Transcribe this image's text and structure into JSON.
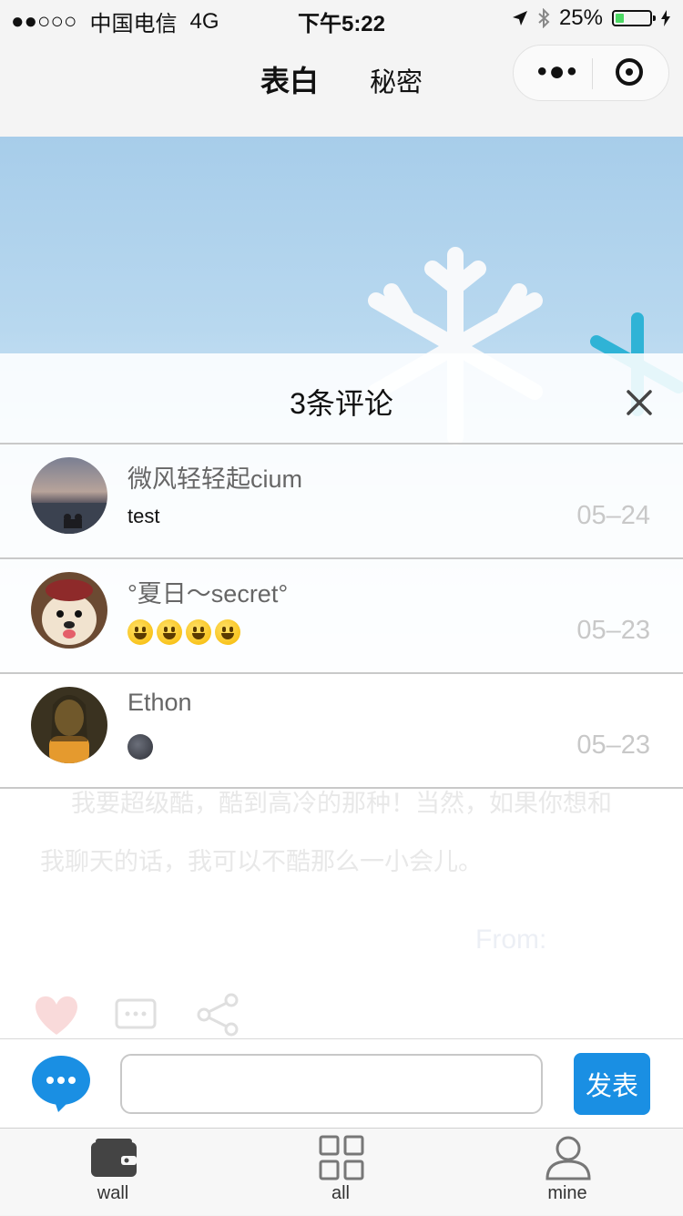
{
  "status_bar": {
    "signal": "●●○○○",
    "carrier": "中国电信",
    "network": "4G",
    "time": "下午5:22",
    "battery_text": "25%",
    "battery_level": 0.25
  },
  "nav": {
    "tab_active": "表白",
    "tab_other": "秘密"
  },
  "sheet": {
    "title": "3条评论",
    "comments": [
      {
        "name": "微风轻轻起cium",
        "text": "test",
        "date": "05–24",
        "avatar": "sunset-avatar"
      },
      {
        "name": "°夏日～secret°",
        "text": "",
        "emoji": [
          "grinning-face",
          "grinning-face",
          "grinning-face",
          "grinning-face"
        ],
        "date": "05–23",
        "avatar": "dog-avatar"
      },
      {
        "name": "Ethon",
        "text": "",
        "emoji": [
          "new-moon-face"
        ],
        "date": "05–23",
        "avatar": "mona-lisa-avatar"
      }
    ]
  },
  "background_post": {
    "line1": "我要超级酷，酷到高冷的那种！当然，如果你想和",
    "line2": "我聊天的话，我可以不酷那么一小会儿。",
    "from_label": "From:"
  },
  "input_bar": {
    "placeholder": "",
    "value": "",
    "send_label": "发表"
  },
  "tabbar": {
    "items": [
      {
        "label": "wall",
        "icon": "wallet-icon"
      },
      {
        "label": "all",
        "icon": "grid-icon"
      },
      {
        "label": "mine",
        "icon": "person-icon"
      }
    ]
  },
  "colors": {
    "accent": "#1a8fe3",
    "battery": "#4cd964",
    "date_text": "#c8c8c8"
  }
}
